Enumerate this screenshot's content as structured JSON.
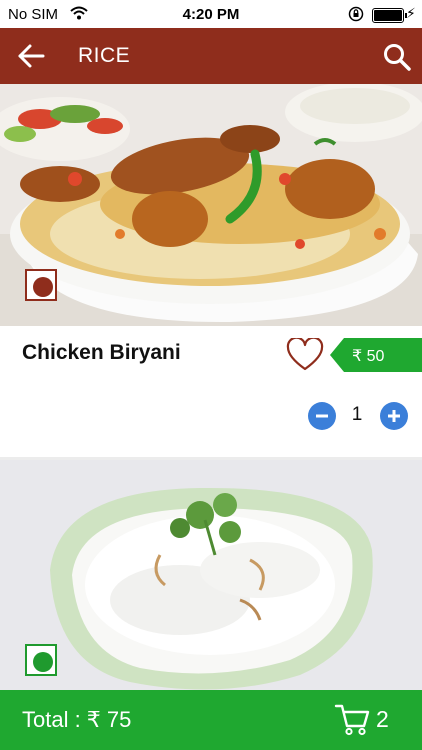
{
  "status_bar": {
    "carrier": "No SIM",
    "time": "4:20 PM"
  },
  "app_bar": {
    "title": "RICE",
    "back_icon": "arrow-left-icon",
    "search_icon": "search-icon"
  },
  "items": [
    {
      "name": "Chicken Biryani",
      "price": "₹ 50",
      "quantity": "1",
      "diet": "non-veg",
      "favorite_icon": "heart-outline-icon"
    },
    {
      "diet": "veg"
    }
  ],
  "footer": {
    "total": "Total : ₹ 75",
    "cart_count": "2",
    "cart_icon": "cart-icon"
  },
  "colors": {
    "app_bar": "#8f2d1c",
    "accent_green": "#1fa830",
    "quantity_button": "#3b7fd9",
    "non_veg": "#8f2d1c",
    "veg": "#1f9a2e"
  }
}
